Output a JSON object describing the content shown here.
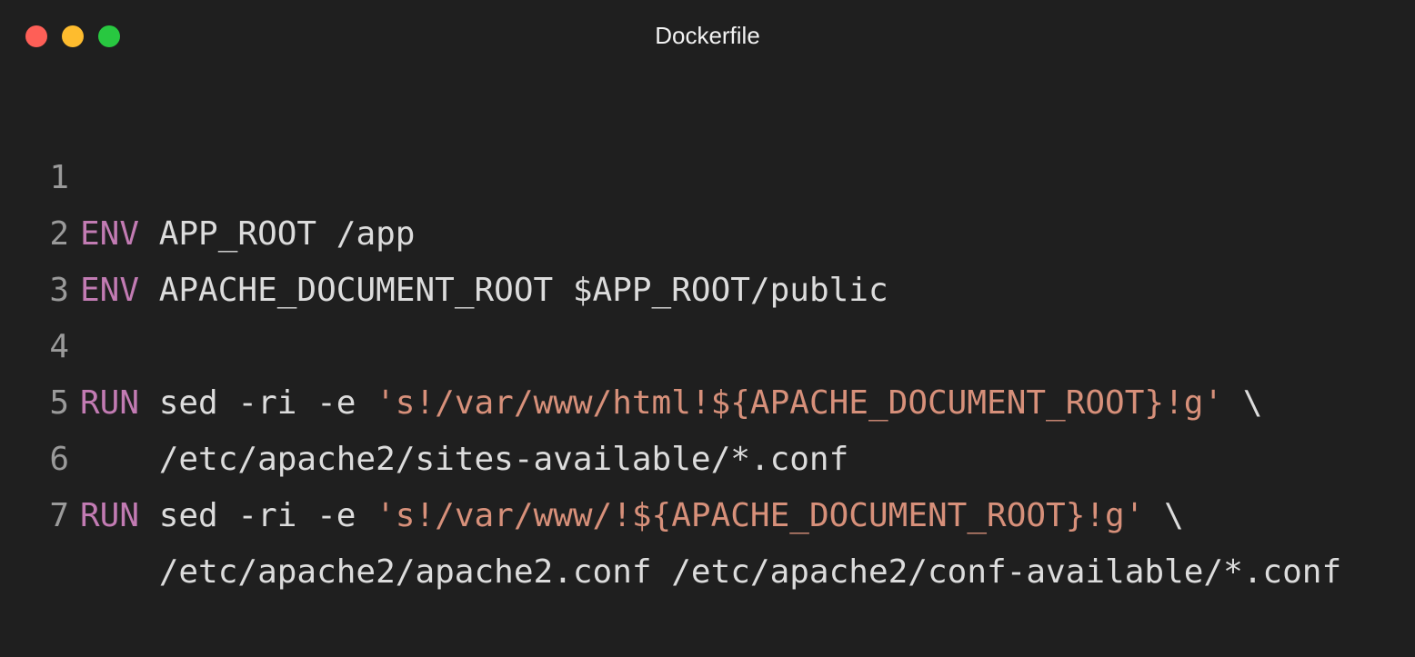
{
  "window": {
    "title": "Dockerfile"
  },
  "colors": {
    "background": "#1f1f1f",
    "keyword": "#c27bb3",
    "string": "#d7907a",
    "text": "#dcdcdc",
    "line_number": "#9a9a9a",
    "close": "#fe5f57",
    "minimize": "#febc2e",
    "zoom": "#28c840"
  },
  "code": {
    "lines": [
      {
        "number": "1",
        "keyword": "ENV",
        "rest": " APP_ROOT /app",
        "string": "",
        "tail": ""
      },
      {
        "number": "2",
        "keyword": "ENV",
        "rest": " APACHE_DOCUMENT_ROOT $APP_ROOT/public",
        "string": "",
        "tail": ""
      },
      {
        "number": "3",
        "keyword": "",
        "rest": "",
        "string": "",
        "tail": ""
      },
      {
        "number": "4",
        "keyword": "RUN",
        "rest": " sed -ri -e ",
        "string": "'s!/var/www/html!${APACHE_DOCUMENT_ROOT}!g'",
        "tail": " \\"
      },
      {
        "number": "5",
        "keyword": "",
        "rest": "    /etc/apache2/sites-available/*.conf",
        "string": "",
        "tail": ""
      },
      {
        "number": "6",
        "keyword": "RUN",
        "rest": " sed -ri -e ",
        "string": "'s!/var/www/!${APACHE_DOCUMENT_ROOT}!g'",
        "tail": " \\"
      },
      {
        "number": "7",
        "keyword": "",
        "rest": "    /etc/apache2/apache2.conf /etc/apache2/conf-available/*.conf",
        "string": "",
        "tail": ""
      }
    ]
  }
}
